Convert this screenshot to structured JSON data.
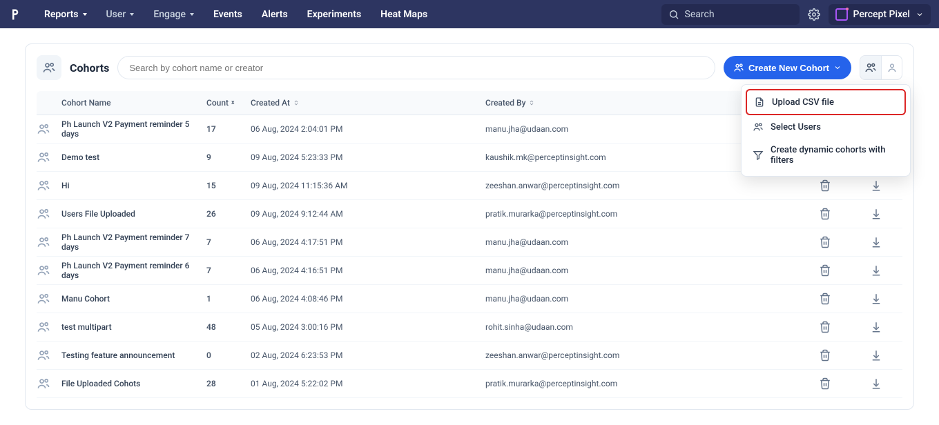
{
  "nav": {
    "reports": "Reports",
    "user": "User",
    "engage": "Engage",
    "events": "Events",
    "alerts": "Alerts",
    "experiments": "Experiments",
    "heatmaps": "Heat Maps",
    "search": "Search",
    "org": "Percept Pixel"
  },
  "page": {
    "title": "Cohorts",
    "search_placeholder": "Search by cohort name or creator",
    "create_label": "Create New Cohort"
  },
  "dropdown": {
    "upload": "Upload CSV file",
    "select": "Select Users",
    "dynamic": "Create dynamic cohorts with filters"
  },
  "columns": {
    "name": "Cohort Name",
    "count": "Count",
    "created_at": "Created At",
    "created_by": "Created By"
  },
  "rows": [
    {
      "name": "Ph Launch V2 Payment reminder 5 days",
      "count": "17",
      "created_at": "06 Aug, 2024 2:04:01 PM",
      "created_by": "manu.jha@udaan.com"
    },
    {
      "name": "Demo test",
      "count": "9",
      "created_at": "09 Aug, 2024 5:23:33 PM",
      "created_by": "kaushik.mk@perceptinsight.com"
    },
    {
      "name": "Hi",
      "count": "15",
      "created_at": "09 Aug, 2024 11:15:36 AM",
      "created_by": "zeeshan.anwar@perceptinsight.com"
    },
    {
      "name": "Users File Uploaded",
      "count": "26",
      "created_at": "09 Aug, 2024 9:12:44 AM",
      "created_by": "pratik.murarka@perceptinsight.com"
    },
    {
      "name": "Ph Launch V2 Payment reminder 7 days",
      "count": "7",
      "created_at": "06 Aug, 2024 4:17:51 PM",
      "created_by": "manu.jha@udaan.com"
    },
    {
      "name": "Ph Launch V2 Payment reminder 6 days",
      "count": "7",
      "created_at": "06 Aug, 2024 4:16:51 PM",
      "created_by": "manu.jha@udaan.com"
    },
    {
      "name": "Manu Cohort",
      "count": "1",
      "created_at": "06 Aug, 2024 4:08:46 PM",
      "created_by": "manu.jha@udaan.com"
    },
    {
      "name": "test multipart",
      "count": "48",
      "created_at": "05 Aug, 2024 3:00:16 PM",
      "created_by": "rohit.sinha@udaan.com"
    },
    {
      "name": "Testing feature announcement",
      "count": "0",
      "created_at": "02 Aug, 2024 6:23:53 PM",
      "created_by": "zeeshan.anwar@perceptinsight.com"
    },
    {
      "name": "File Uploaded Cohots",
      "count": "28",
      "created_at": "01 Aug, 2024 5:22:02 PM",
      "created_by": "pratik.murarka@perceptinsight.com"
    }
  ]
}
